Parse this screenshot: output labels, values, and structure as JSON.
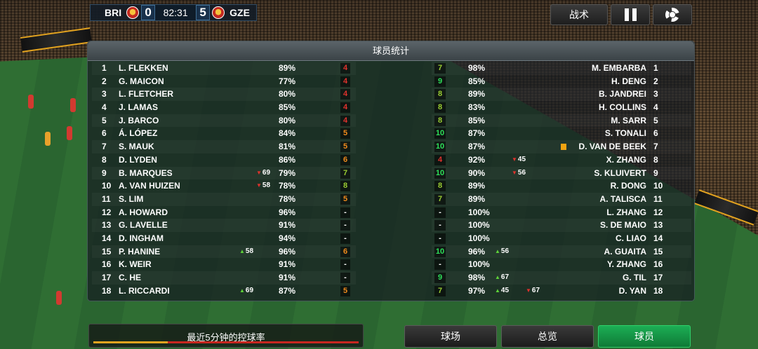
{
  "scoreboard": {
    "home_team": "BRI",
    "home_score": "0",
    "clock": "82:31",
    "away_score": "5",
    "away_team": "GZE"
  },
  "top_buttons": {
    "tactics_label": "战术",
    "pause_icon": "pause-icon",
    "settings_icon": "gear-icon"
  },
  "panel": {
    "title": "球员统计"
  },
  "home_players": [
    {
      "num": "1",
      "name": "L. FLEKKEN",
      "pct": "89%",
      "rating": "4",
      "rating_color": "#e0322d",
      "sub": ""
    },
    {
      "num": "2",
      "name": "G. MAICON",
      "pct": "77%",
      "rating": "4",
      "rating_color": "#e0322d",
      "sub": ""
    },
    {
      "num": "3",
      "name": "L. FLETCHER",
      "pct": "80%",
      "rating": "4",
      "rating_color": "#e0322d",
      "sub": ""
    },
    {
      "num": "4",
      "name": "J. LAMAS",
      "pct": "85%",
      "rating": "4",
      "rating_color": "#e0322d",
      "sub": ""
    },
    {
      "num": "5",
      "name": "J. BARCO",
      "pct": "80%",
      "rating": "4",
      "rating_color": "#e0322d",
      "sub": ""
    },
    {
      "num": "6",
      "name": "Á. LÓPEZ",
      "pct": "84%",
      "rating": "5",
      "rating_color": "#f08a1c",
      "sub": ""
    },
    {
      "num": "7",
      "name": "S. MAUK",
      "pct": "81%",
      "rating": "5",
      "rating_color": "#f08a1c",
      "sub": ""
    },
    {
      "num": "8",
      "name": "D. LYDEN",
      "pct": "86%",
      "rating": "6",
      "rating_color": "#f08a1c",
      "sub": ""
    },
    {
      "num": "9",
      "name": "B. MARQUES",
      "pct": "79%",
      "rating": "7",
      "rating_color": "#9acd32",
      "sub": "69",
      "sub_type": "out"
    },
    {
      "num": "10",
      "name": "A. VAN HUIZEN",
      "pct": "78%",
      "rating": "8",
      "rating_color": "#9acd32",
      "sub": "58",
      "sub_type": "out"
    },
    {
      "num": "11",
      "name": "S. LIM",
      "pct": "78%",
      "rating": "5",
      "rating_color": "#f08a1c",
      "sub": ""
    },
    {
      "num": "12",
      "name": "A. HOWARD",
      "pct": "96%",
      "rating": "-",
      "rating_color": "#ffffff",
      "sub": ""
    },
    {
      "num": "13",
      "name": "G. LAVELLE",
      "pct": "91%",
      "rating": "-",
      "rating_color": "#ffffff",
      "sub": ""
    },
    {
      "num": "14",
      "name": "D. INGHAM",
      "pct": "94%",
      "rating": "-",
      "rating_color": "#ffffff",
      "sub": ""
    },
    {
      "num": "15",
      "name": "P. HANINE",
      "pct": "96%",
      "rating": "6",
      "rating_color": "#f08a1c",
      "sub": "58",
      "sub_type": "in"
    },
    {
      "num": "16",
      "name": "K. WEIR",
      "pct": "91%",
      "rating": "-",
      "rating_color": "#ffffff",
      "sub": ""
    },
    {
      "num": "17",
      "name": "C. HE",
      "pct": "91%",
      "rating": "-",
      "rating_color": "#ffffff",
      "sub": ""
    },
    {
      "num": "18",
      "name": "L. RICCARDI",
      "pct": "87%",
      "rating": "5",
      "rating_color": "#f08a1c",
      "sub": "69",
      "sub_type": "in"
    }
  ],
  "away_players": [
    {
      "num": "1",
      "name": "M. EMBARBA",
      "pct": "98%",
      "rating": "7",
      "rating_color": "#9acd32",
      "subs": []
    },
    {
      "num": "2",
      "name": "H. DENG",
      "pct": "85%",
      "rating": "9",
      "rating_color": "#2ee05a",
      "subs": []
    },
    {
      "num": "3",
      "name": "B. JANDREI",
      "pct": "89%",
      "rating": "8",
      "rating_color": "#9acd32",
      "subs": []
    },
    {
      "num": "4",
      "name": "H. COLLINS",
      "pct": "83%",
      "rating": "8",
      "rating_color": "#9acd32",
      "subs": []
    },
    {
      "num": "5",
      "name": "M. SARR",
      "pct": "85%",
      "rating": "8",
      "rating_color": "#9acd32",
      "subs": []
    },
    {
      "num": "6",
      "name": "S. TONALI",
      "pct": "87%",
      "rating": "10",
      "rating_color": "#2ee05a",
      "subs": []
    },
    {
      "num": "7",
      "name": "D. VAN DE BEEK",
      "pct": "87%",
      "rating": "10",
      "rating_color": "#2ee05a",
      "subs": [],
      "yellow_card": true
    },
    {
      "num": "8",
      "name": "X. ZHANG",
      "pct": "92%",
      "rating": "4",
      "rating_color": "#e0322d",
      "subs": [
        {
          "type": "out",
          "min": "45"
        }
      ]
    },
    {
      "num": "9",
      "name": "S. KLUIVERT",
      "pct": "90%",
      "rating": "10",
      "rating_color": "#2ee05a",
      "subs": [
        {
          "type": "out",
          "min": "56"
        }
      ]
    },
    {
      "num": "10",
      "name": "R. DONG",
      "pct": "89%",
      "rating": "8",
      "rating_color": "#9acd32",
      "subs": []
    },
    {
      "num": "11",
      "name": "A. TALISCA",
      "pct": "89%",
      "rating": "7",
      "rating_color": "#9acd32",
      "subs": []
    },
    {
      "num": "12",
      "name": "L. ZHANG",
      "pct": "100%",
      "rating": "-",
      "rating_color": "#ffffff",
      "subs": []
    },
    {
      "num": "13",
      "name": "S. DE MAIO",
      "pct": "100%",
      "rating": "-",
      "rating_color": "#ffffff",
      "subs": []
    },
    {
      "num": "14",
      "name": "C. LIAO",
      "pct": "100%",
      "rating": "-",
      "rating_color": "#ffffff",
      "subs": []
    },
    {
      "num": "15",
      "name": "A. GUAITA",
      "pct": "96%",
      "rating": "10",
      "rating_color": "#2ee05a",
      "subs": [
        {
          "type": "in",
          "min": "56"
        }
      ]
    },
    {
      "num": "16",
      "name": "Y. ZHANG",
      "pct": "100%",
      "rating": "-",
      "rating_color": "#ffffff",
      "subs": []
    },
    {
      "num": "17",
      "name": "G. TIL",
      "pct": "98%",
      "rating": "9",
      "rating_color": "#2ee05a",
      "subs": [
        {
          "type": "in",
          "min": "67"
        }
      ]
    },
    {
      "num": "18",
      "name": "D. YAN",
      "pct": "97%",
      "rating": "7",
      "rating_color": "#9acd32",
      "subs": [
        {
          "type": "in",
          "min": "45"
        },
        {
          "type": "out",
          "min": "67"
        }
      ]
    }
  ],
  "possession": {
    "label": "最近5分钟的控球率",
    "home_share": 0.28,
    "home_color": "#e3a31f",
    "away_color": "#c72720"
  },
  "bottom_tabs": [
    {
      "label": "球场",
      "active": false
    },
    {
      "label": "总览",
      "active": false
    },
    {
      "label": "球员",
      "active": true
    }
  ]
}
